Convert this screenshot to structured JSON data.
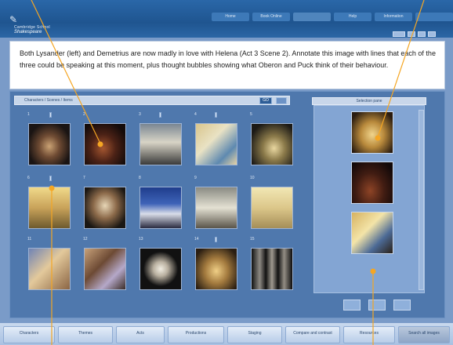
{
  "header": {
    "logo_line1": "Cambridge School",
    "logo_line2": "Shakespeare",
    "nav": [
      "Home",
      "Book Online",
      "",
      "Help",
      "Information",
      "",
      ""
    ]
  },
  "instruction": {
    "text": "Both Lysander (left) and Demetrius are now madly in love with Helena (Act 3 Scene 2). Annotate this image with lines that each of the three could be speaking at this moment, plus thought bubbles showing what Oberon and Puck think of their behaviour."
  },
  "gallery": {
    "search_label": "Characters / Scenes / Items",
    "go_label": "GO",
    "numbers": [
      "1",
      "2",
      "3",
      "4",
      "5",
      "6",
      "7",
      "8",
      "9",
      "10",
      "11",
      "12",
      "13",
      "14",
      "15"
    ]
  },
  "selection": {
    "header": "Selection pane"
  },
  "bottom_tabs": [
    "Characters",
    "Themes",
    "Acts",
    "Productions",
    "Staging",
    "Compare and contrast",
    "Resources",
    "Search all images"
  ],
  "colors": {
    "topbar": "#1f5590",
    "panel": "#4f78ad",
    "accent": "#f5a623"
  }
}
